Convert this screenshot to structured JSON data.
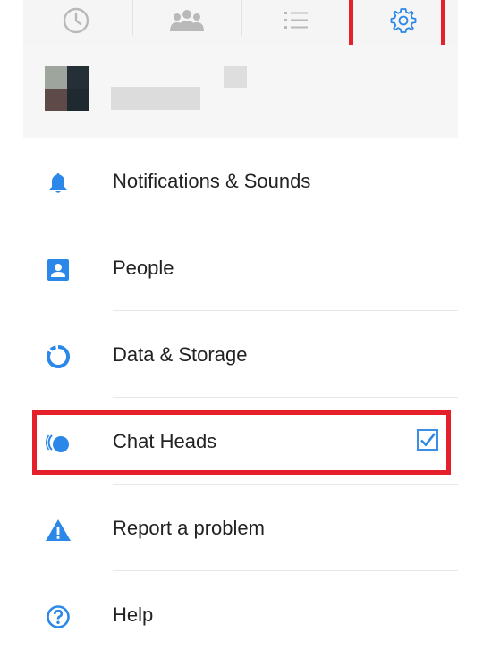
{
  "tabs": [
    {
      "icon": "clock-icon"
    },
    {
      "icon": "people-icon"
    },
    {
      "icon": "list-icon"
    },
    {
      "icon": "gear-icon",
      "active": true
    }
  ],
  "menu": [
    {
      "id": "notifications",
      "icon": "bell-icon",
      "label": "Notifications & Sounds"
    },
    {
      "id": "people",
      "icon": "contact-card-icon",
      "label": "People"
    },
    {
      "id": "data-storage",
      "icon": "ring-icon",
      "label": "Data & Storage"
    },
    {
      "id": "chat-heads",
      "icon": "chat-heads-icon",
      "label": "Chat Heads",
      "checked": true
    },
    {
      "id": "report",
      "icon": "warning-icon",
      "label": "Report a problem"
    },
    {
      "id": "help",
      "icon": "help-circle-icon",
      "label": "Help"
    }
  ],
  "colors": {
    "accent": "#2b88e8",
    "highlight": "#e6202b"
  }
}
